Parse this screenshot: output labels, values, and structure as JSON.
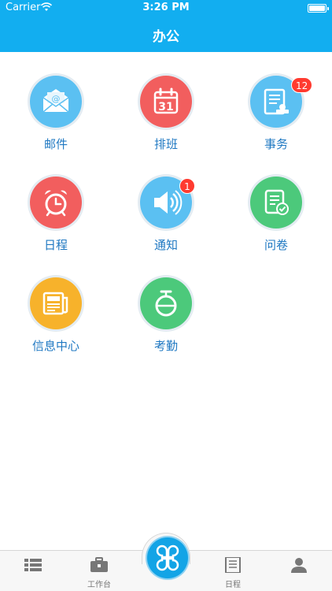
{
  "status_bar": {
    "carrier": "Carrier",
    "time": "3:26 PM"
  },
  "header": {
    "title": "办公"
  },
  "apps": [
    {
      "label": "邮件",
      "icon": "mail-icon",
      "color": "#5bc0f2"
    },
    {
      "label": "排班",
      "icon": "calendar-icon",
      "color": "#f25e5e",
      "calendar_day": "31"
    },
    {
      "label": "事务",
      "icon": "document-stamp-icon",
      "color": "#5bc0f2",
      "badge": "12"
    },
    {
      "label": "日程",
      "icon": "alarm-clock-icon",
      "color": "#f25e5e"
    },
    {
      "label": "通知",
      "icon": "speaker-icon",
      "color": "#5bc0f2",
      "badge": "1"
    },
    {
      "label": "问卷",
      "icon": "questionnaire-check-icon",
      "color": "#4cc97b"
    },
    {
      "label": "信息中心",
      "icon": "newspaper-icon",
      "color": "#f7b22b"
    },
    {
      "label": "考勤",
      "icon": "stopwatch-icon",
      "color": "#4cc97b"
    }
  ],
  "tabbar": {
    "tabs": [
      {
        "icon": "list-icon",
        "label": ""
      },
      {
        "icon": "briefcase-icon",
        "label": "工作台"
      },
      {
        "icon": "schedule-icon",
        "label": "日程"
      },
      {
        "icon": "user-icon",
        "label": ""
      }
    ],
    "center_icon": "clover-icon"
  },
  "colors": {
    "header": "#12aef0",
    "label": "#1f78c2",
    "badge": "#ff3b30"
  }
}
